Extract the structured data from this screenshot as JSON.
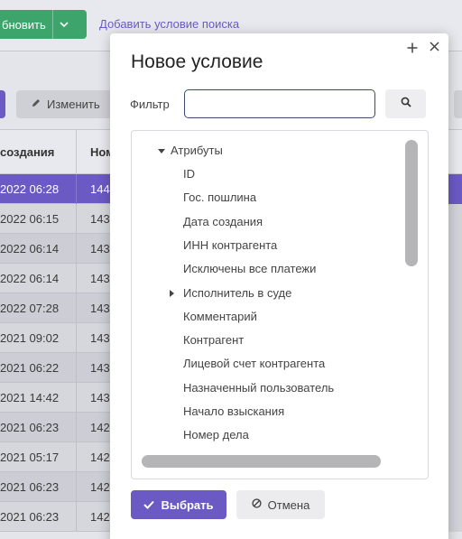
{
  "background": {
    "refresh_label": "бновить",
    "add_condition_link": "Добавить условие поиска",
    "edit_label": "Изменить",
    "columns": [
      "создания",
      "Ном"
    ],
    "rows": [
      {
        "date": "2022 06:28",
        "num": "144",
        "selected": true
      },
      {
        "date": "2022 06:15",
        "num": "143"
      },
      {
        "date": "2022 06:14",
        "num": "143"
      },
      {
        "date": "2022 06:14",
        "num": "143"
      },
      {
        "date": "2022 07:28",
        "num": "143"
      },
      {
        "date": "2021 09:02",
        "num": "143"
      },
      {
        "date": "2021 06:22",
        "num": "143"
      },
      {
        "date": "2021 14:42",
        "num": "143"
      },
      {
        "date": "2021 06:23",
        "num": "142"
      },
      {
        "date": "2021 05:17",
        "num": "142"
      },
      {
        "date": "2021 06:23",
        "num": "142"
      },
      {
        "date": "2021 06:23",
        "num": "142"
      }
    ]
  },
  "dialog": {
    "title": "Новое условие",
    "filter_label": "Фильтр",
    "filter_value": "",
    "tree_root": "Атрибуты",
    "tree_items": [
      {
        "label": "ID",
        "has_children": false
      },
      {
        "label": "Гос. пошлина",
        "has_children": false
      },
      {
        "label": "Дата создания",
        "has_children": false
      },
      {
        "label": "ИНН контрагента",
        "has_children": false
      },
      {
        "label": "Исключены все платежи",
        "has_children": false
      },
      {
        "label": "Исполнитель в суде",
        "has_children": true
      },
      {
        "label": "Комментарий",
        "has_children": false
      },
      {
        "label": "Контрагент",
        "has_children": false
      },
      {
        "label": "Лицевой счет контрагента",
        "has_children": false
      },
      {
        "label": "Назначенный пользователь",
        "has_children": false
      },
      {
        "label": "Начало взыскания",
        "has_children": false
      },
      {
        "label": "Номер дела",
        "has_children": false
      }
    ],
    "select_label": "Выбрать",
    "cancel_label": "Отмена"
  },
  "colors": {
    "accent": "#6b5ac4",
    "green": "#3da46c"
  },
  "icons": [
    "plus-icon",
    "close-icon",
    "search-icon",
    "caret-down-icon",
    "caret-right-icon",
    "check-icon",
    "ban-icon",
    "pencil-icon",
    "chevron-down-icon"
  ]
}
